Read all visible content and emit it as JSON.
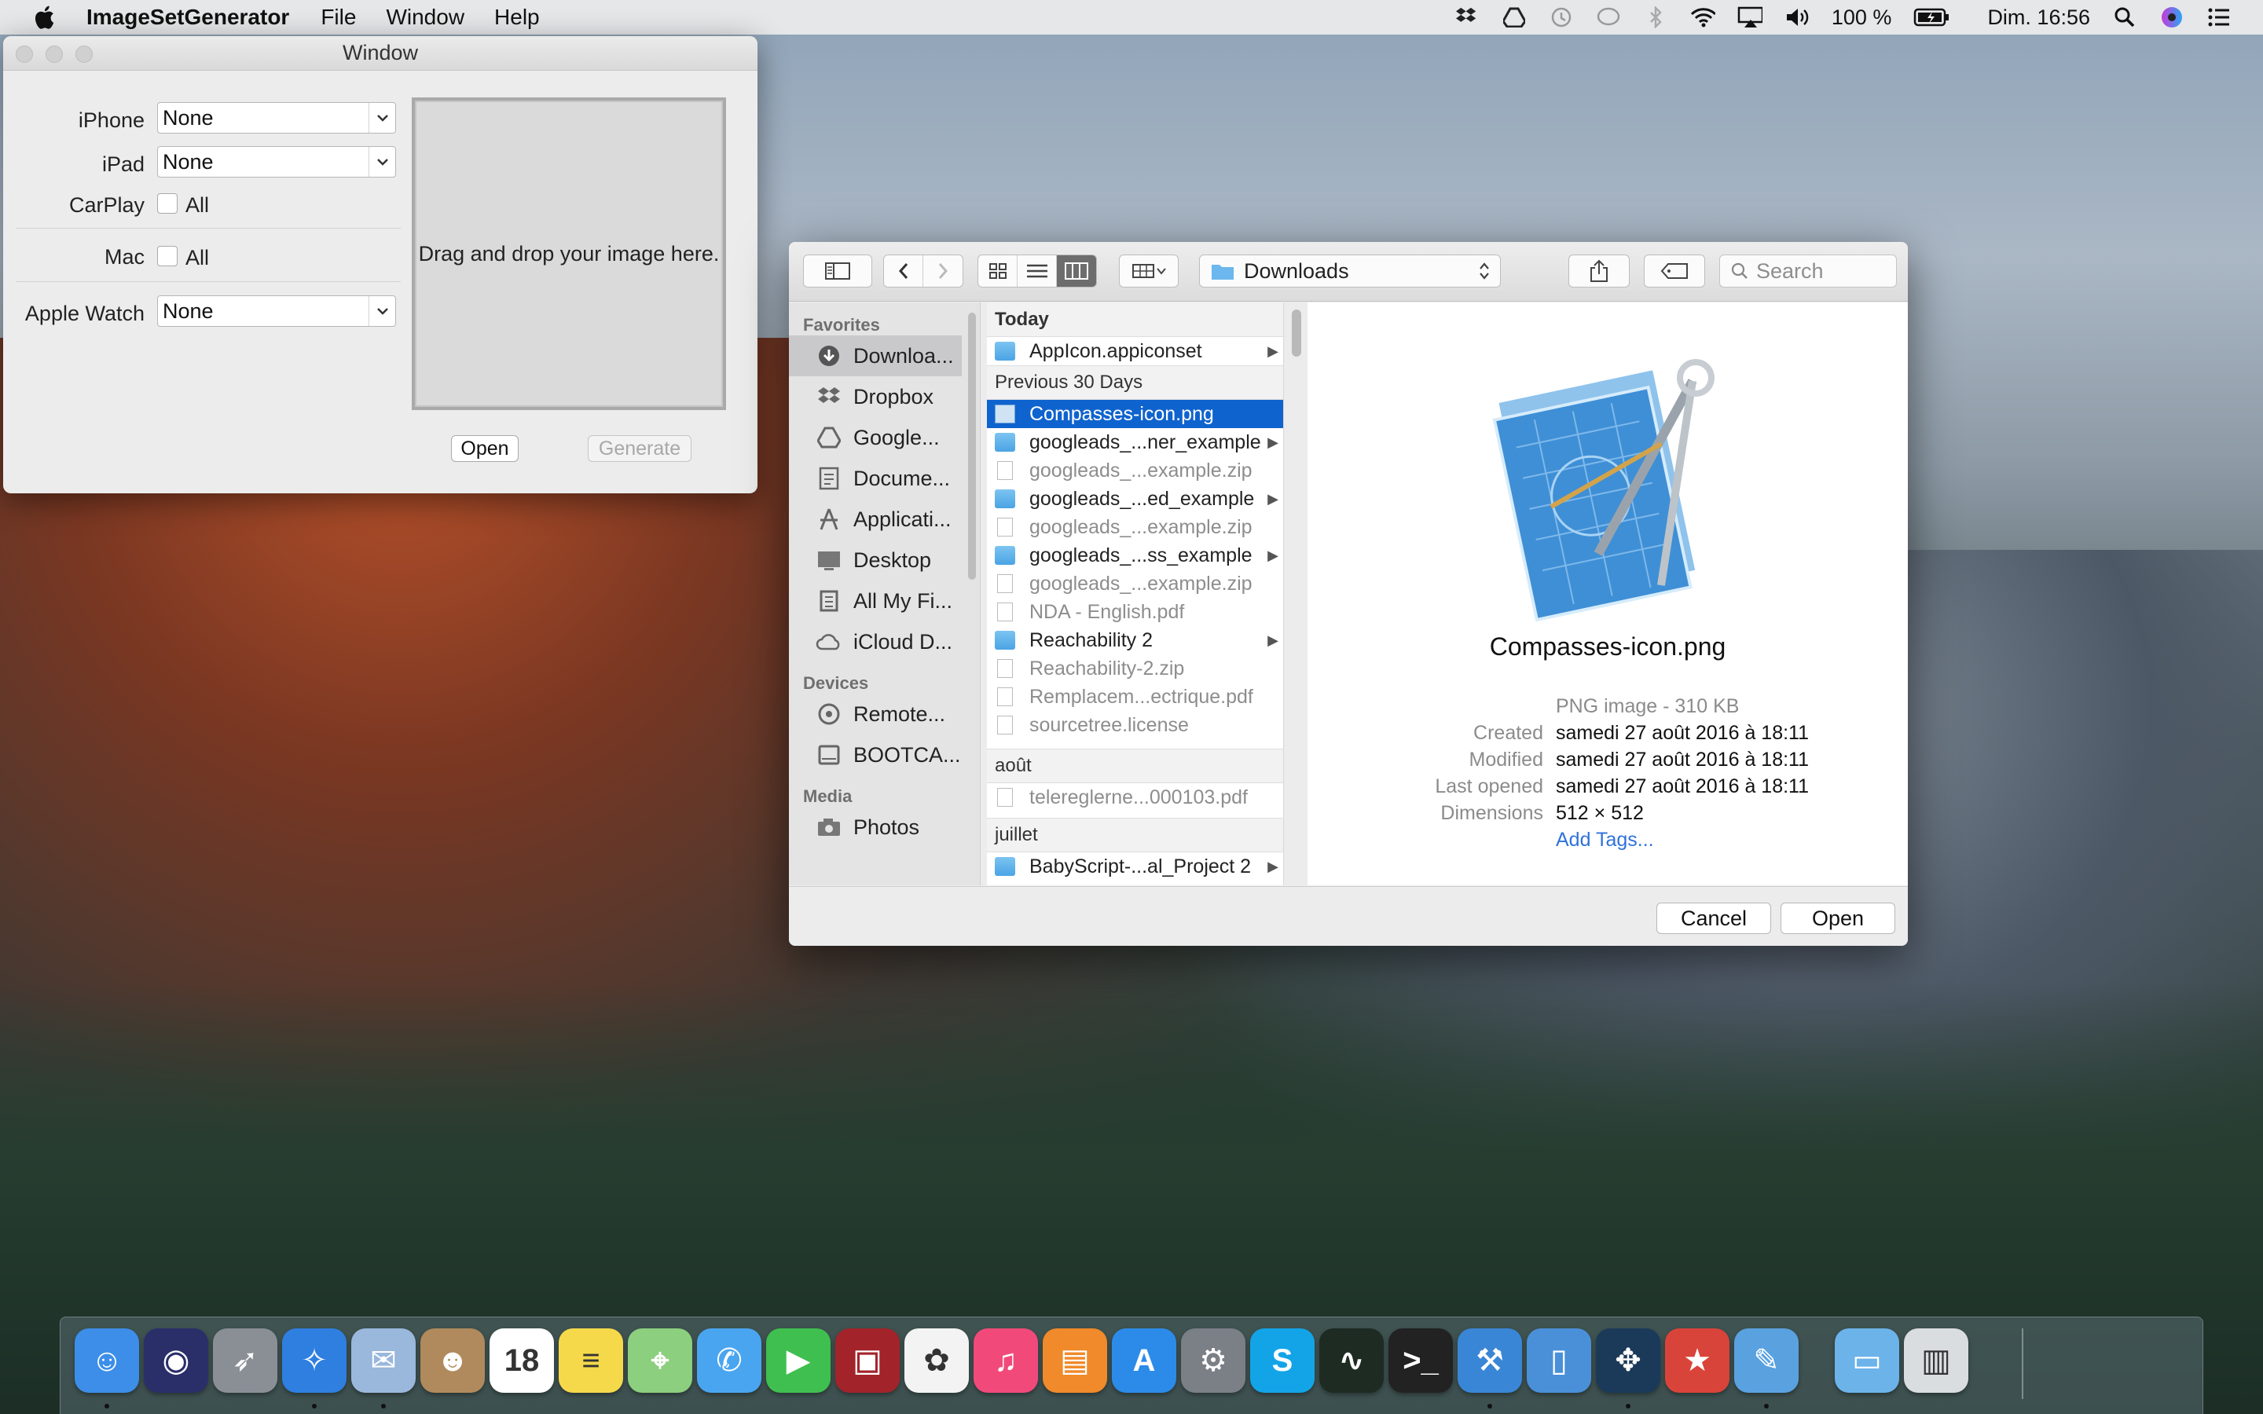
{
  "menubar": {
    "app_name": "ImageSetGenerator",
    "menus": [
      "File",
      "Window",
      "Help"
    ],
    "battery": "100 %",
    "clock": "Dim. 16:56"
  },
  "window": {
    "title": "Window",
    "rows": {
      "iphone": {
        "label": "iPhone",
        "value": "None"
      },
      "ipad": {
        "label": "iPad",
        "value": "None"
      },
      "carplay": {
        "label": "CarPlay",
        "check": "All"
      },
      "mac": {
        "label": "Mac",
        "check": "All"
      },
      "watch": {
        "label": "Apple Watch",
        "value": "None"
      }
    },
    "drop_text": "Drag and drop your image here.",
    "open_label": "Open",
    "generate_label": "Generate"
  },
  "panel": {
    "location": "Downloads",
    "search_placeholder": "Search",
    "sidebar": {
      "favorites_header": "Favorites",
      "favorites": [
        {
          "label": "Downloa...",
          "icon": "downloads-icon"
        },
        {
          "label": "Dropbox",
          "icon": "dropbox-icon"
        },
        {
          "label": "Google...",
          "icon": "google-drive-icon"
        },
        {
          "label": "Docume...",
          "icon": "documents-icon"
        },
        {
          "label": "Applicati...",
          "icon": "applications-icon"
        },
        {
          "label": "Desktop",
          "icon": "desktop-icon"
        },
        {
          "label": "All My Fi...",
          "icon": "all-files-icon"
        },
        {
          "label": "iCloud D...",
          "icon": "icloud-icon"
        }
      ],
      "devices_header": "Devices",
      "devices": [
        {
          "label": "Remote...",
          "icon": "remote-disc-icon"
        },
        {
          "label": "BOOTCA...",
          "icon": "disk-icon"
        }
      ],
      "media_header": "Media",
      "media": [
        {
          "label": "Photos",
          "icon": "camera-icon"
        }
      ]
    },
    "sections": {
      "today": "Today",
      "previous": "Previous 30 Days",
      "aout": "août",
      "juillet": "juillet"
    },
    "files_today": [
      {
        "name": "AppIcon.appiconset",
        "kind": "folder"
      }
    ],
    "files_previous": [
      {
        "name": "Compasses-icon.png",
        "kind": "image",
        "selected": true
      },
      {
        "name": "googleads_...ner_example",
        "kind": "folder"
      },
      {
        "name": "googleads_...example.zip",
        "kind": "doc"
      },
      {
        "name": "googleads_...ed_example",
        "kind": "folder"
      },
      {
        "name": "googleads_...example.zip",
        "kind": "doc"
      },
      {
        "name": "googleads_...ss_example",
        "kind": "folder"
      },
      {
        "name": "googleads_...example.zip",
        "kind": "doc"
      },
      {
        "name": "NDA - English.pdf",
        "kind": "doc"
      },
      {
        "name": "Reachability 2",
        "kind": "folder"
      },
      {
        "name": "Reachability-2.zip",
        "kind": "doc"
      },
      {
        "name": "Remplacem...ectrique.pdf",
        "kind": "doc"
      },
      {
        "name": "sourcetree.license",
        "kind": "doc"
      }
    ],
    "files_aout": [
      {
        "name": "telereglerne...000103.pdf",
        "kind": "doc"
      }
    ],
    "files_juillet": [
      {
        "name": "BabyScript-...al_Project 2",
        "kind": "folder"
      }
    ],
    "preview": {
      "name": "Compasses-icon.png",
      "kind": "PNG image - 310 KB",
      "created_label": "Created",
      "created": "samedi 27 août 2016 à 18:11",
      "modified_label": "Modified",
      "modified": "samedi 27 août 2016 à 18:11",
      "opened_label": "Last opened",
      "opened": "samedi 27 août 2016 à 18:11",
      "dims_label": "Dimensions",
      "dims": "512 × 512",
      "add_tags": "Add Tags..."
    },
    "cancel_label": "Cancel",
    "open_label": "Open"
  },
  "dock": {
    "apps": [
      {
        "name": "Finder",
        "color": "#3c8ee8",
        "glyph": "☺",
        "running": true
      },
      {
        "name": "Siri",
        "color": "#2a2f6a",
        "glyph": "◉",
        "running": false
      },
      {
        "name": "Launchpad",
        "color": "#8a8f96",
        "glyph": "➶",
        "running": false
      },
      {
        "name": "Safari",
        "color": "#2e7fe0",
        "glyph": "✧",
        "running": true
      },
      {
        "name": "Mail",
        "color": "#9ab7dc",
        "glyph": "✉",
        "running": true
      },
      {
        "name": "Contacts",
        "color": "#b08a5c",
        "glyph": "☻",
        "running": false
      },
      {
        "name": "Calendar",
        "color": "#ffffff",
        "glyph": "18",
        "running": false
      },
      {
        "name": "Notes",
        "color": "#f5d94b",
        "glyph": "≡",
        "running": false
      },
      {
        "name": "Maps",
        "color": "#8ccf7e",
        "glyph": "⌖",
        "running": false
      },
      {
        "name": "Messages",
        "color": "#4aa5f0",
        "glyph": "✆",
        "running": false
      },
      {
        "name": "FaceTime",
        "color": "#3fbf4f",
        "glyph": "▶",
        "running": false
      },
      {
        "name": "Photo Booth",
        "color": "#a2242a",
        "glyph": "▣",
        "running": false
      },
      {
        "name": "Photos",
        "color": "#f3f3f3",
        "glyph": "✿",
        "running": false
      },
      {
        "name": "iTunes",
        "color": "#f14a7a",
        "glyph": "♫",
        "running": false
      },
      {
        "name": "iBooks",
        "color": "#f08a2a",
        "glyph": "▤",
        "running": false
      },
      {
        "name": "App Store",
        "color": "#2c8be8",
        "glyph": "A",
        "running": false
      },
      {
        "name": "System Preferences",
        "color": "#7b7f86",
        "glyph": "⚙",
        "running": false
      },
      {
        "name": "Skype",
        "color": "#13a4e8",
        "glyph": "S",
        "running": false
      },
      {
        "name": "Activity Monitor",
        "color": "#1d2b22",
        "glyph": "∿",
        "running": false
      },
      {
        "name": "Terminal",
        "color": "#222222",
        "glyph": ">_",
        "running": false
      },
      {
        "name": "Xcode",
        "color": "#3a86d6",
        "glyph": "⚒",
        "running": true
      },
      {
        "name": "Simulator",
        "color": "#4a90d9",
        "glyph": "▯",
        "running": false
      },
      {
        "name": "SourceTree",
        "color": "#1b3a5a",
        "glyph": "✥",
        "running": true
      },
      {
        "name": "Wunderlist",
        "color": "#d9443a",
        "glyph": "★",
        "running": false
      },
      {
        "name": "ImageSetGenerator",
        "color": "#5aa1e0",
        "glyph": "✎",
        "running": true
      },
      {
        "name": "Downloads Stack",
        "color": "#6cb3ea",
        "glyph": "▭",
        "running": false
      },
      {
        "name": "Trash",
        "color": "#d9dde0",
        "glyph": "▥",
        "running": false
      }
    ]
  }
}
